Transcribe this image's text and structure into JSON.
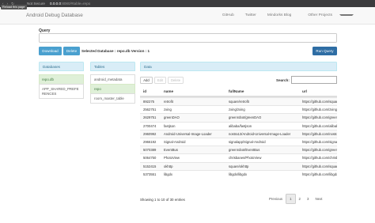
{
  "browser": {
    "security_label": "Not Secure",
    "url_host": "0.0.0.0",
    "url_rest": ":8080/#table=repo",
    "tooltip": "Reload this page"
  },
  "navbar": {
    "brand": "Android Debug Database",
    "links": [
      "GitHub",
      "Twitter",
      "Mindorks Blog",
      "Other Projects"
    ]
  },
  "query": {
    "label": "Query",
    "value": "",
    "download_label": "Download",
    "delete_label": "Delete",
    "selected_db_text": "Selected Database : repo.db Version : 1",
    "run_label": "Run Query"
  },
  "databases": {
    "header": "Databases",
    "items": [
      "repo.db",
      "APP_SHARED_PREFERENCES"
    ]
  },
  "tables": {
    "header": "Tables",
    "items": [
      "android_metadata",
      "repo",
      "room_master_table"
    ]
  },
  "data": {
    "header": "Data",
    "add_label": "Add",
    "edit_label": "Edit",
    "delete_label": "Delete",
    "search_label": "Search:",
    "search_value": "",
    "columns": [
      "id",
      "name",
      "fullName",
      "url"
    ],
    "rows": [
      [
        "892275",
        "retrofit",
        "square/retrofit",
        "https://github.com/square"
      ],
      [
        "2562751",
        "zxing",
        "zxing/zxing",
        "https://github.com/zxing"
      ],
      [
        "2629751",
        "greenDAO",
        "greenrobot/greenDAO",
        "https://github.com/green"
      ],
      [
        "2700474",
        "fastjson",
        "alibaba/fastjson",
        "https://github.com/alibab"
      ],
      [
        "2960992",
        "Android-Universal-Image-Loader",
        "nostra13/Android-Universal-Image-Loader",
        "https://github.com/nostra"
      ],
      [
        "2966192",
        "Signal-Android",
        "signalapp/Signal-Android",
        "https://github.com/signal"
      ],
      [
        "5070389",
        "EventBus",
        "greenrobot/EventBus",
        "https://github.com/green"
      ],
      [
        "5064750",
        "PhotoView",
        "chrisbanes/PhotoView",
        "https://github.com/chrisb"
      ],
      [
        "5152415",
        "okhttp",
        "square/okhttp",
        "https://github.com/square"
      ],
      [
        "5373551",
        "libgdx",
        "libgdx/libgdx",
        "https://github.com/libgdx"
      ]
    ],
    "info": "Showing 1 to 10 of 30 entries",
    "pagination": {
      "previous": "Previous",
      "pages": [
        "1",
        "2",
        "3"
      ],
      "current": "1",
      "next": "Next"
    }
  },
  "colors": {
    "panel_heading_bg": "#d9edf7",
    "active_item_bg": "#dff0d8",
    "primary_button": "#2e6da4",
    "info_button": "#4aa0cf"
  }
}
